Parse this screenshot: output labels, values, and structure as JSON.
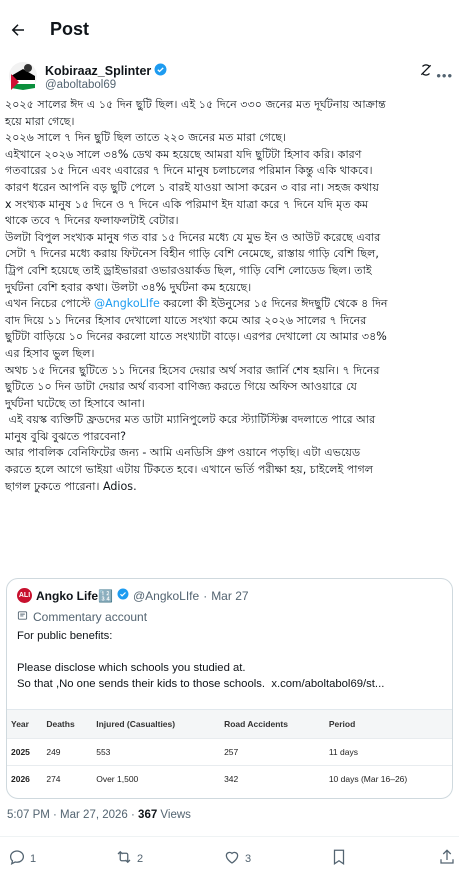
{
  "header": {
    "title": "Post"
  },
  "author": {
    "name": "Kobiraaz_Splinter",
    "handle": "@aboltabol69"
  },
  "post": {
    "text_1": "২০২৫ সালের ঈদ এ ১৫ দিন ছুটি ছিল। এই ১৫ দিনে ৩৩০ জনের মত দূর্ঘটনায় আক্রান্ত\nহয়ে মারা গেছে।\n২০২৬ সালে ৭ দিন ছুটি ছিল তাতে ২২০ জনের মত মারা গেছে।\nএইখানে ২০২৬ সালে ৩৪% ডেথ কম হয়েছে আমরা যদি ছুটিটা হিসাব করি। কারণ\nগতবারের ১৫ দিনে এবং এবারের ৭ দিনে মানুষ চলাচলের পরিমান কিন্তু একি থাকবে।\nকারণ ধরেন আপনি বড় ছুটি পেলে ১ বারই যাওয়া আসা করেন ৩ বার না। সহজ কথায়\nx সংখ্যক মানুষ ১৫ দিনে ও ৭ দিনে একি পরিমাণ ইদ যাত্রা করে ৭ দিনে যদি মৃত কম\nথাকে তবে ৭ দিনের ফলাফলটাই বেটার।\nউলটা বিপুল সংখ্যক মানুষ গত বার ১৫ দিনের মধ্যে যে মুভ ইন ও আউট করেছে এবার\nসেটা ৭ দিনের মধ্যে করায় ফিটনেস বিহীন গাড়ি বেশি নেমেছে, রাস্তায় গাড়ি বেশি ছিল,\nট্রিপ বেশি হয়েছে তাই ড্রাইভাররা ওভারওয়ার্কড ছিল, গাড়ি বেশি লোডেড ছিল। তাই\nদুর্ঘটনা বেশি হবার কথা। উলটা ৩৪% দুর্ঘটনা কম হয়েছে।\nএখন নিচের পোস্টে ",
    "mention": "@AngkoLIfe",
    "text_2": " করলো কী ইউনুসের ১৫ দিনের ঈদছুটি থেকে ৪ দিন\nবাদ দিয়ে ১১ দিনের হিসাব দেখালো যাতে সংখ্যা কমে আর ২০২৬ সালের ৭ দিনের\nছুটিটা বাড়িয়ে ১০ দিনের করলো যাতে সংখ্যাটা বাড়ে। এরপর দেখালো যে আমার ৩৪%\nএর হিসাব ভুল ছিল।\nঅথচ ১৫ দিনের ছুটিতে ১১ দিনের হিসেব দেয়ার অর্থ সবার জার্নি শেষ হয়নি। ৭ দিনের\nছুটিতে ১০ দিন ডাটা দেয়ার অর্থ ব্যবসা বাণিজ্য করতে গিয়ে অফিস আওয়ারে যে\nদুর্ঘটনা ঘটেছে তা হিসাবে আনা।\n এই বয়স্ক ব্যক্তিটি ফ্রডদের মত ডাটা ম্যানিপুলেট করে স্ট্যাটিস্টিক্স বদলাতে পারে আর\nমানুষ বুঝি বুঝতে পারবেনা?\nআর পাবলিক বেনিফিটের জন্য - আমি এনডিসি গ্রুপ ওয়ানে পড়ছি। এটা এভয়েড\nকরতে হলে আগে ভাইয়া এটায় টিকতে হবে। এখানে ভর্তি পরীক্ষা হয়, চাইলেই পাগল\nছাগল ঢুকতে পারেনা। Adios."
  },
  "quote": {
    "avatar_text": "ALI",
    "name": "Angko Life🔢",
    "handle": "@AngkoLIfe",
    "dot": "·",
    "date": "Mar 27",
    "note": "Commentary account",
    "text": "For public benefits:\n\nPlease disclose which schools you studied at.\nSo that ,No one sends their kids to those schools.  x.com/aboltabol69/st...",
    "table": {
      "headers": [
        "Year",
        "Deaths",
        "Injured (Casualties)",
        "Road Accidents",
        "Period"
      ],
      "rows": [
        [
          "2025",
          "249",
          "553",
          "257",
          "11 days"
        ],
        [
          "2026",
          "274",
          "Over 1,500",
          "342",
          "10 days (Mar 16–26)"
        ]
      ]
    }
  },
  "meta": {
    "time": "5:07 PM · Mar 27, 2026 · ",
    "views": "367",
    "views_label": " Views"
  },
  "actions": {
    "replies": "1",
    "reposts": "2",
    "likes": "3"
  }
}
